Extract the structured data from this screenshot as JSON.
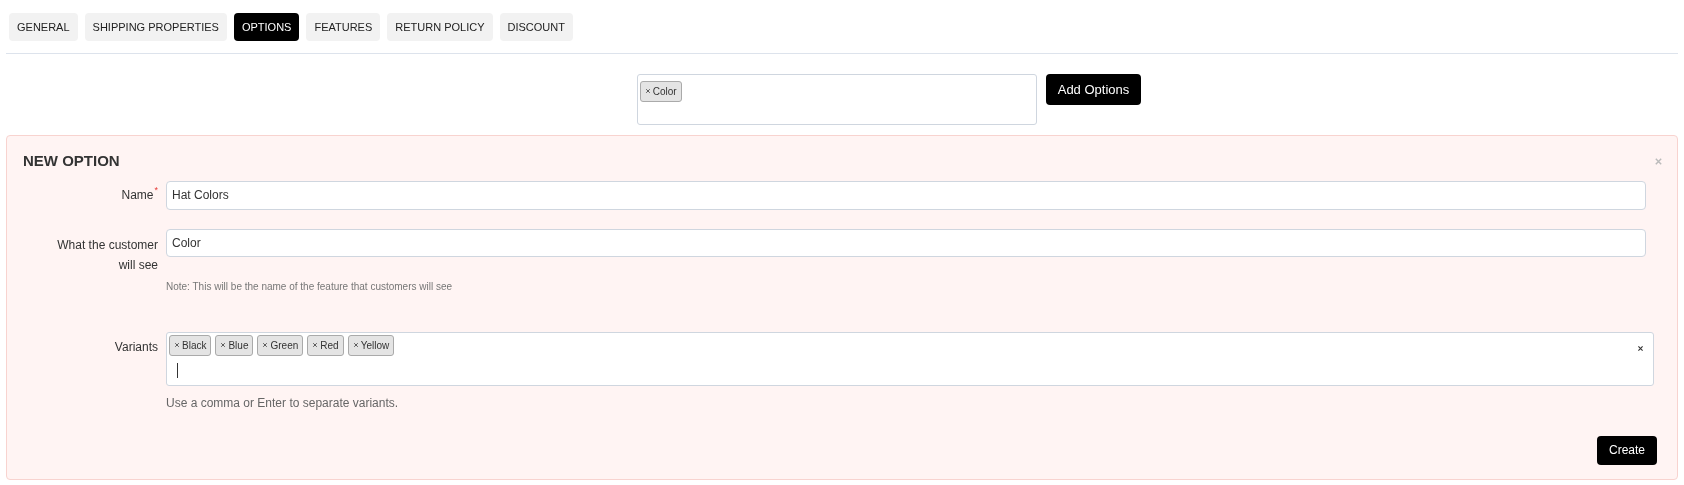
{
  "tabs": [
    {
      "label": "GENERAL",
      "selected": false
    },
    {
      "label": "SHIPPING PROPERTIES",
      "selected": false
    },
    {
      "label": "OPTIONS",
      "selected": true
    },
    {
      "label": "FEATURES",
      "selected": false
    },
    {
      "label": "RETURN POLICY",
      "selected": false
    },
    {
      "label": "DISCOUNT",
      "selected": false
    }
  ],
  "options_field": {
    "tags": [
      "Color"
    ]
  },
  "add_button": "Add Options",
  "panel": {
    "title": "NEW OPTION",
    "name_field": {
      "label": "Name",
      "required_mark": "*",
      "value": "Hat Colors"
    },
    "customer_field": {
      "label": "What the customer will see",
      "value": "Color",
      "note": "Note: This will be the name of the feature that customers will see"
    },
    "variants_field": {
      "label": "Variants",
      "tags": [
        "Black",
        "Blue",
        "Green",
        "Red",
        "Yellow"
      ],
      "help": "Use a comma or Enter to separate variants."
    },
    "create_button": "Create"
  }
}
